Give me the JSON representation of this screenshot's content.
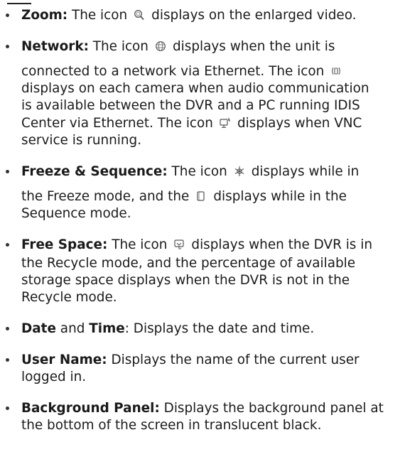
{
  "items": [
    {
      "id": "zoom",
      "term": "Zoom:",
      "icon": "magnifier-icon",
      "line1_a": " The icon",
      "line1_b": "displays on the enlarged video."
    },
    {
      "id": "network",
      "term": "Network:",
      "icons": [
        "globe-icon",
        "audio-icon",
        "vnc-icon"
      ],
      "line1_a": " The icon",
      "line1_b": "displays when the unit is",
      "line2_a": "connected to a network via Ethernet. The icon",
      "line3": "displays on each camera when audio communication",
      "line4": "is available between the DVR and a PC running IDIS",
      "line5_a": "Center via Ethernet. The icon",
      "line5_b": "displays when VNC",
      "line6": "service is running."
    },
    {
      "id": "freeze-sequence",
      "term": "Freeze & Sequence:",
      "icons": [
        "freeze-icon",
        "sequence-icon"
      ],
      "line1_a": " The icon",
      "line1_b": "displays while in",
      "line2_a": "the Freeze mode, and the",
      "line2_b": "displays while in the",
      "line3": "Sequence mode."
    },
    {
      "id": "free-space",
      "term": "Free Space:",
      "icon": "recycle-icon",
      "line1_a": " The icon",
      "line1_b": "displays when the DVR is in",
      "line2": "the Recycle mode, and the percentage of available",
      "line3": "storage space displays when the DVR is not in the",
      "line4": "Recycle mode."
    },
    {
      "id": "date-time",
      "term1": "Date",
      "mid": " and ",
      "term2": "Time",
      "rest": ": Displays the date and time."
    },
    {
      "id": "user-name",
      "term": "User Name:",
      "line1": " Displays the name of the current user",
      "line2": "logged in."
    },
    {
      "id": "background-panel",
      "term": "Background Panel:",
      "line1": " Displays the background panel at",
      "line2": "the bottom of the screen in translucent black."
    }
  ]
}
